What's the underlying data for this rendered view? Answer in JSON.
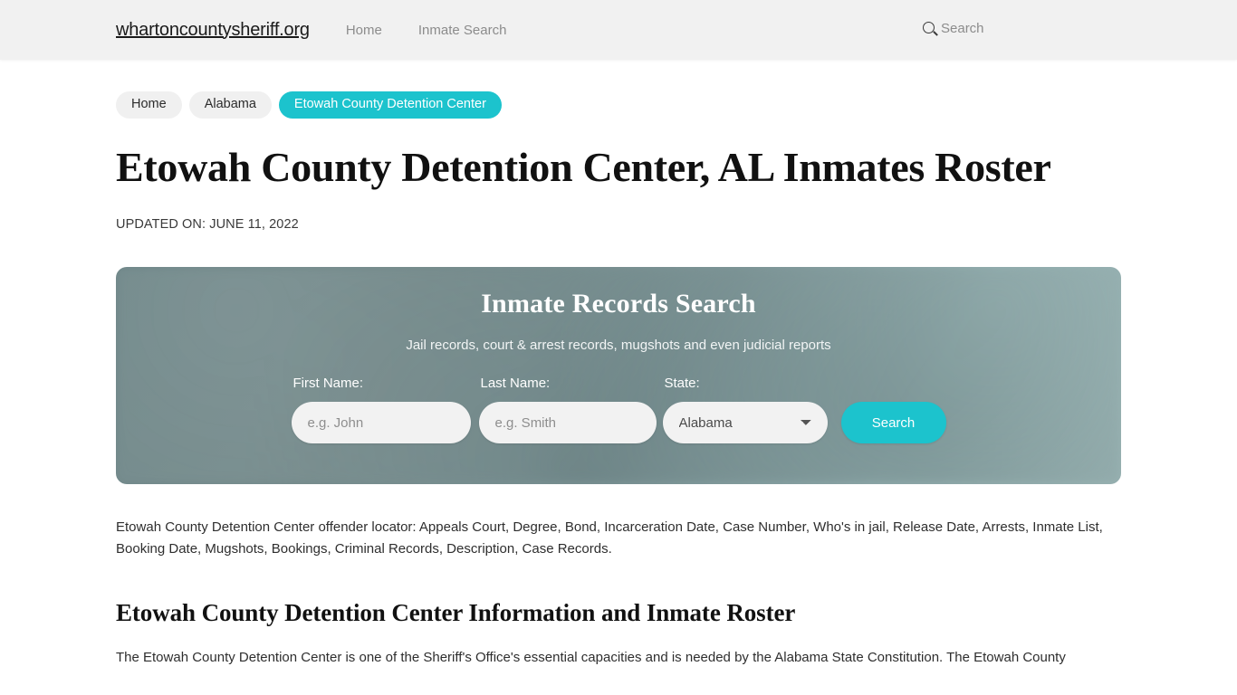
{
  "header": {
    "brand": "whartoncountysheriff.org",
    "nav": [
      {
        "label": "Home"
      },
      {
        "label": "Inmate Search"
      }
    ],
    "search_label": "Search",
    "search_icon": "search-icon"
  },
  "breadcrumb": [
    {
      "label": "Home",
      "active": false
    },
    {
      "label": "Alabama",
      "active": false
    },
    {
      "label": "Etowah County Detention Center",
      "active": true
    }
  ],
  "article": {
    "title": "Etowah County Detention Center, AL Inmates Roster",
    "updated": "UPDATED ON: JUNE 11, 2022",
    "lead": "Etowah County Detention Center offender locator: Appeals Court, Degree, Bond, Incarceration Date, Case Number, Who's in jail, Release Date, Arrests, Inmate List, Booking Date, Mugshots, Bookings, Criminal Records, Description, Case Records.",
    "section_heading": "Etowah County Detention Center Information and Inmate Roster",
    "body_text": "The Etowah County Detention Center is one of the Sheriff's Office's essential capacities and is needed by the Alabama State Constitution. The Etowah County"
  },
  "search_panel": {
    "title": "Inmate Records Search",
    "subtitle": "Jail records, court & arrest records, mugshots and even judicial reports",
    "first_name": {
      "label": "First Name:",
      "placeholder": "e.g. John",
      "value": ""
    },
    "last_name": {
      "label": "Last Name:",
      "placeholder": "e.g. Smith",
      "value": ""
    },
    "state": {
      "label": "State:",
      "selected": "Alabama",
      "options": [
        "Alabama"
      ]
    },
    "submit_label": "Search"
  },
  "colors": {
    "accent_teal": "#1cc3cd",
    "panel_slate": "#7e9698",
    "header_bg": "#f1f1f1",
    "field_bg": "#f2f2f2"
  }
}
